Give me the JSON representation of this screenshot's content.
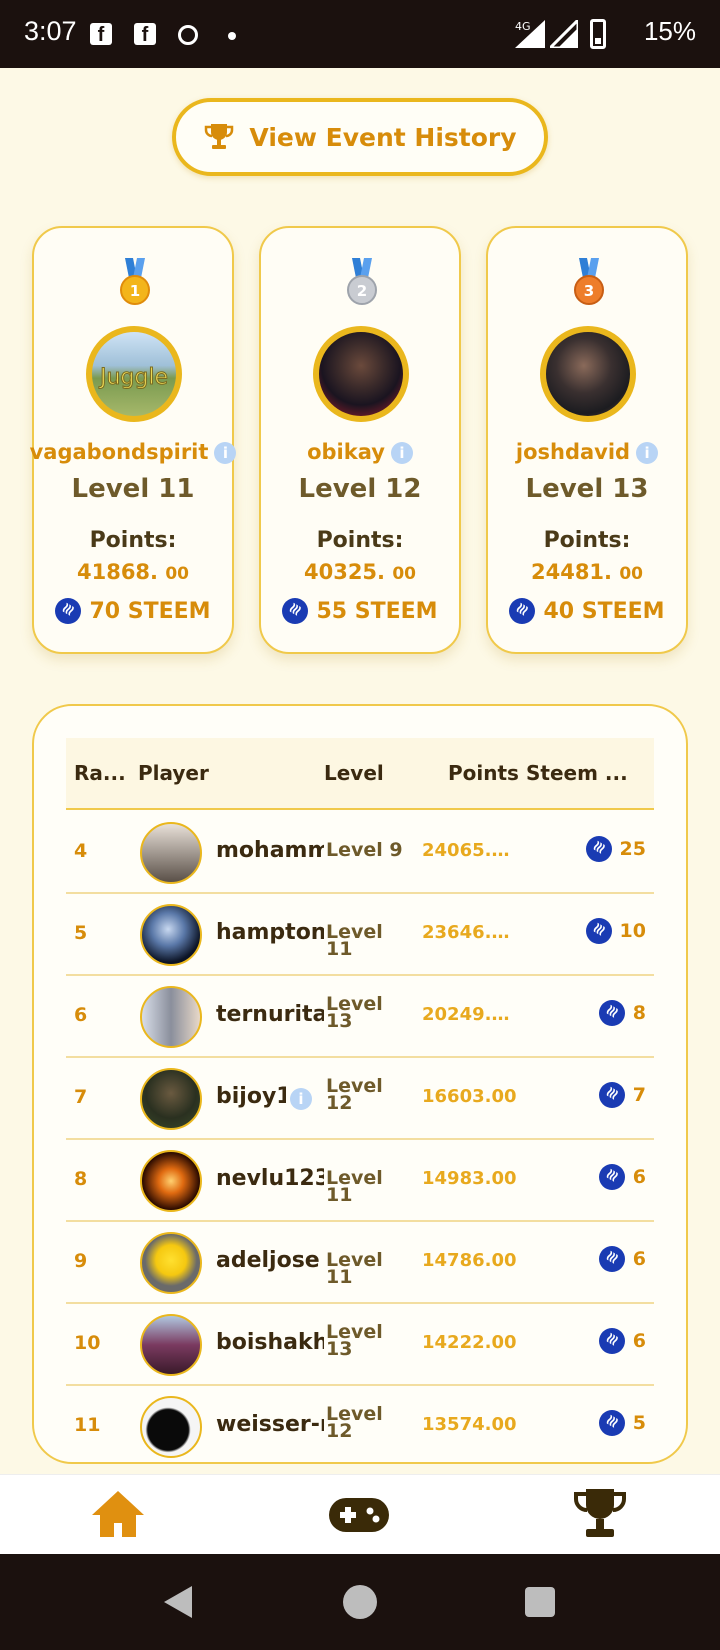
{
  "status_bar": {
    "time": "3:07",
    "network": "4G",
    "battery": "15%"
  },
  "history_button": {
    "label": "View Event History",
    "icon": "trophy-icon"
  },
  "podium": [
    {
      "medal": "1",
      "name": "vagabondspirit",
      "level": "Level 11",
      "points_label": "Points:",
      "points_main": "41868.",
      "points_dec": "00",
      "steem": "70 STEEM",
      "avatar_text": "Juggle"
    },
    {
      "medal": "2",
      "name": "obikay",
      "level": "Level 12",
      "points_label": "Points:",
      "points_main": "40325.",
      "points_dec": "00",
      "steem": "55 STEEM"
    },
    {
      "medal": "3",
      "name": "joshdavid",
      "level": "Level 13",
      "points_label": "Points:",
      "points_main": "24481.",
      "points_dec": "00",
      "steem": "40 STEEM"
    }
  ],
  "table": {
    "headers": {
      "rank": "Ra...",
      "player": "Player",
      "level": "Level",
      "points": "Points",
      "steem": "Steem ..."
    },
    "rows": [
      {
        "rank": "4",
        "name": "mohammed",
        "level": "Level 9",
        "points": "24065.…",
        "steem": "25"
      },
      {
        "rank": "5",
        "name": "hamptonc",
        "level": "Level 11",
        "points": "23646.…",
        "steem": "10"
      },
      {
        "rank": "6",
        "name": "ternuritaj",
        "level": "Level 13",
        "points": "20249.…",
        "steem": "8"
      },
      {
        "rank": "7",
        "name": "bijoy1",
        "level": "Level 12",
        "points": "16603.00",
        "steem": "7"
      },
      {
        "rank": "8",
        "name": "nevlu123",
        "level": "Level 11",
        "points": "14983.00",
        "steem": "6"
      },
      {
        "rank": "9",
        "name": "adeljose",
        "level": "Level 11",
        "points": "14786.00",
        "steem": "6"
      },
      {
        "rank": "10",
        "name": "boishakhi",
        "level": "Level 13",
        "points": "14222.00",
        "steem": "6"
      },
      {
        "rank": "11",
        "name": "weisser-r",
        "level": "Level 12",
        "points": "13574.00",
        "steem": "5"
      }
    ]
  },
  "bottom_nav": [
    "home-icon",
    "gamepad-icon",
    "trophy-icon"
  ],
  "colors": {
    "accent": "#d78c0a",
    "border": "#eab71d",
    "background": "#fdf9e6",
    "steem": "#1a3bb3"
  }
}
